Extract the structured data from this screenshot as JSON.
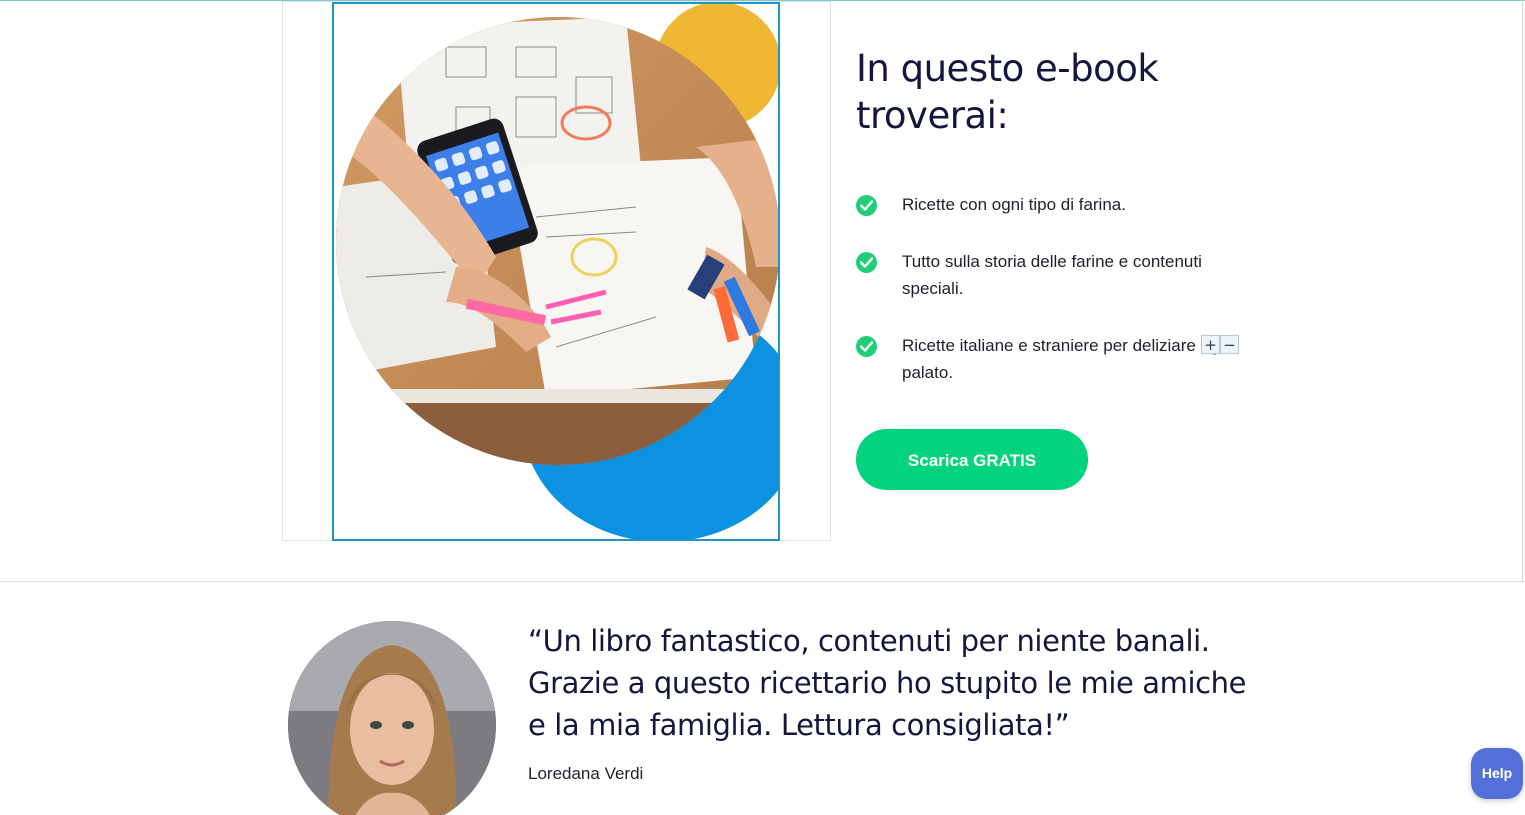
{
  "hero": {
    "heading": "In questo e-book troverai:",
    "features": [
      {
        "text": "Ricette con ogni tipo di farina."
      },
      {
        "text": "Tutto sulla storia delle farine e contenuti speciali."
      },
      {
        "text": "Ricette italiane e straniere per deliziare ogni palato."
      }
    ],
    "editor_controls": {
      "plus": "+",
      "minus": "−"
    },
    "cta_label": "Scarica GRATIS"
  },
  "testimonial": {
    "quote": "“Un libro fantastico, contenuti per niente banali. Grazie a questo ricettario ho stupito le mie amiche e la mia famiglia. Lettura consigliata!”",
    "author": "Loredana Verdi"
  },
  "help_widget": {
    "label": "Help"
  },
  "colors": {
    "accent_green": "#03d37c",
    "heading_navy": "#14163d",
    "deco_yellow": "#f0b734",
    "deco_blue": "#0d92e2",
    "selection_border": "#1f97c2",
    "help_purple": "#5270d8"
  },
  "icons": {
    "feature_bullet": "check-circle-icon"
  }
}
